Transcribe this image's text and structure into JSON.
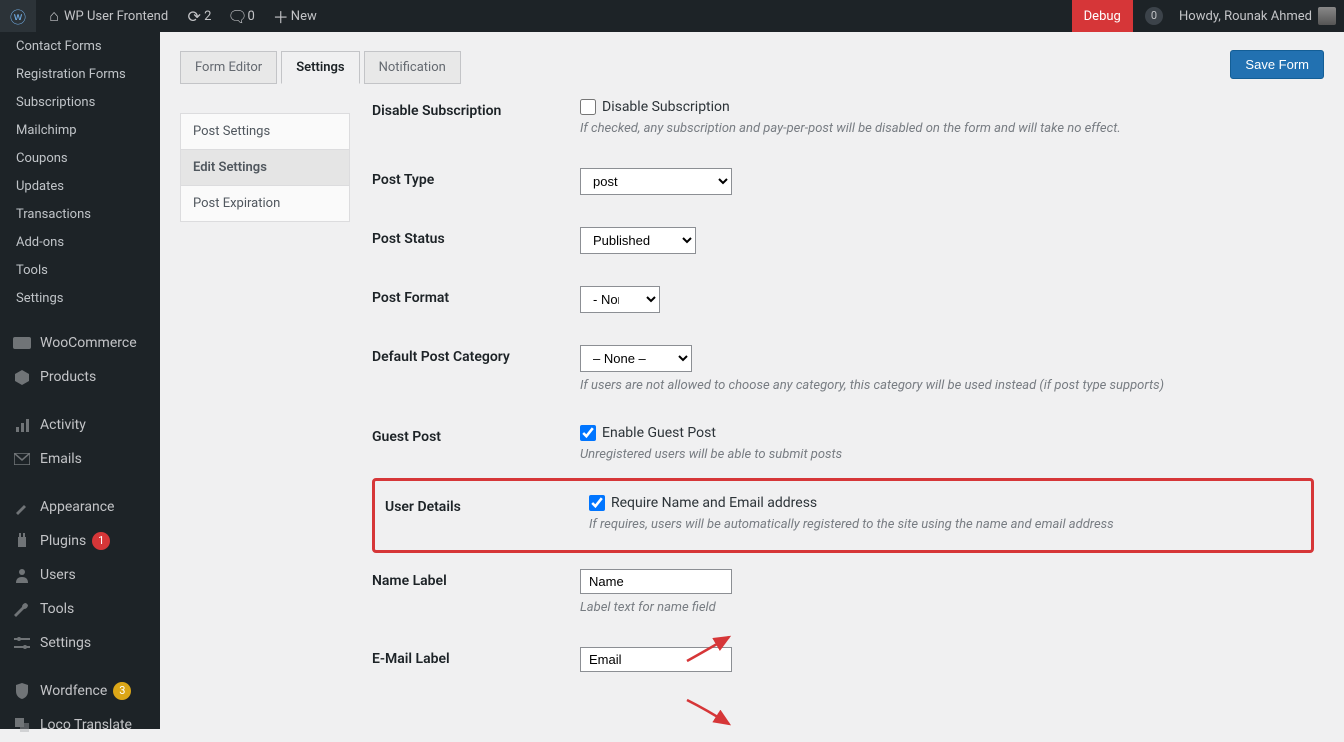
{
  "adminbar": {
    "site": "WP User Frontend",
    "refresh_count": "2",
    "comments_count": "0",
    "new_label": "New",
    "debug_label": "Debug",
    "notif_count": "0",
    "howdy": "Howdy, Rounak Ahmed"
  },
  "sidebar": {
    "items": [
      {
        "label": "Contact Forms",
        "type": "sub"
      },
      {
        "label": "Registration Forms",
        "type": "sub"
      },
      {
        "label": "Subscriptions",
        "type": "sub"
      },
      {
        "label": "Mailchimp",
        "type": "sub"
      },
      {
        "label": "Coupons",
        "type": "sub"
      },
      {
        "label": "Updates",
        "type": "sub"
      },
      {
        "label": "Transactions",
        "type": "sub"
      },
      {
        "label": "Add-ons",
        "type": "sub"
      },
      {
        "label": "Tools",
        "type": "sub"
      },
      {
        "label": "Settings",
        "type": "sub"
      }
    ],
    "woo": "WooCommerce",
    "products": "Products",
    "activity": "Activity",
    "emails": "Emails",
    "appearance": "Appearance",
    "plugins": "Plugins",
    "plugins_count": "1",
    "users": "Users",
    "tools": "Tools",
    "settings": "Settings",
    "wordfence": "Wordfence",
    "wordfence_count": "3",
    "loco": "Loco Translate"
  },
  "tabs": {
    "form_editor": "Form Editor",
    "settings": "Settings",
    "notification": "Notification"
  },
  "save_button": "Save Form",
  "sub_tabs": {
    "post_settings": "Post Settings",
    "edit_settings": "Edit Settings",
    "post_expiration": "Post Expiration"
  },
  "form": {
    "disable_sub": {
      "label": "Disable Subscription",
      "cb": "Disable Subscription",
      "desc": "If checked, any subscription and pay-per-post will be disabled on the form and will take no effect."
    },
    "post_type": {
      "label": "Post Type",
      "value": "post"
    },
    "post_status": {
      "label": "Post Status",
      "value": "Published"
    },
    "post_format": {
      "label": "Post Format",
      "value": "- None -"
    },
    "default_cat": {
      "label": "Default Post Category",
      "value": "– None –",
      "desc": "If users are not allowed to choose any category, this category will be used instead (if post type supports)"
    },
    "guest_post": {
      "label": "Guest Post",
      "cb": "Enable Guest Post",
      "desc": "Unregistered users will be able to submit posts"
    },
    "user_details": {
      "label": "User Details",
      "cb": "Require Name and Email address",
      "desc": "If requires, users will be automatically registered to the site using the name and email address"
    },
    "name_label": {
      "label": "Name Label",
      "value": "Name",
      "desc": "Label text for name field"
    },
    "email_label": {
      "label": "E-Mail Label",
      "value": "Email"
    }
  }
}
